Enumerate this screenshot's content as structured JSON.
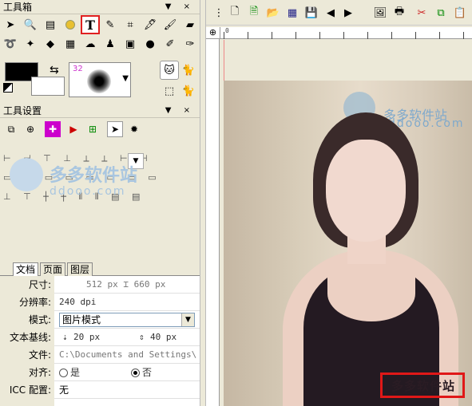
{
  "toolbox": {
    "title": "工具箱",
    "window_buttons": "▼ ×",
    "brush_size": "32"
  },
  "tool_settings": {
    "title": "工具设置",
    "window_buttons": "▼ ×"
  },
  "watermark": {
    "brand": "多多软件站",
    "site": "ddooo.com",
    "corner_text": "多多软件站"
  },
  "tabs": [
    {
      "label": "文档",
      "active": true
    },
    {
      "label": "页面",
      "active": false
    },
    {
      "label": "图层",
      "active": false
    }
  ],
  "doc_props": {
    "size_label": "尺寸:",
    "size_value": "512 px ⌶ 660 px",
    "resolution_label": "分辨率:",
    "resolution_value": "240 dpi",
    "mode_label": "模式:",
    "mode_value": "图片模式",
    "baseline_label": "文本基线:",
    "baseline_a": "20 px",
    "baseline_b": "40 px",
    "file_label": "文件:",
    "file_value": "C:\\Documents and Settings\\Ad",
    "align_label": "对齐:",
    "align_yes": "是",
    "align_no": "否",
    "icc_label": "ICC 配置:",
    "icc_value": "无"
  },
  "ruler": {
    "top_labels": [
      "0",
      "",
      "",
      "",
      "",
      "",
      "",
      "",
      "",
      ""
    ]
  },
  "colors": {
    "accent": "#e01818",
    "panel_bg": "#ece9d8"
  }
}
